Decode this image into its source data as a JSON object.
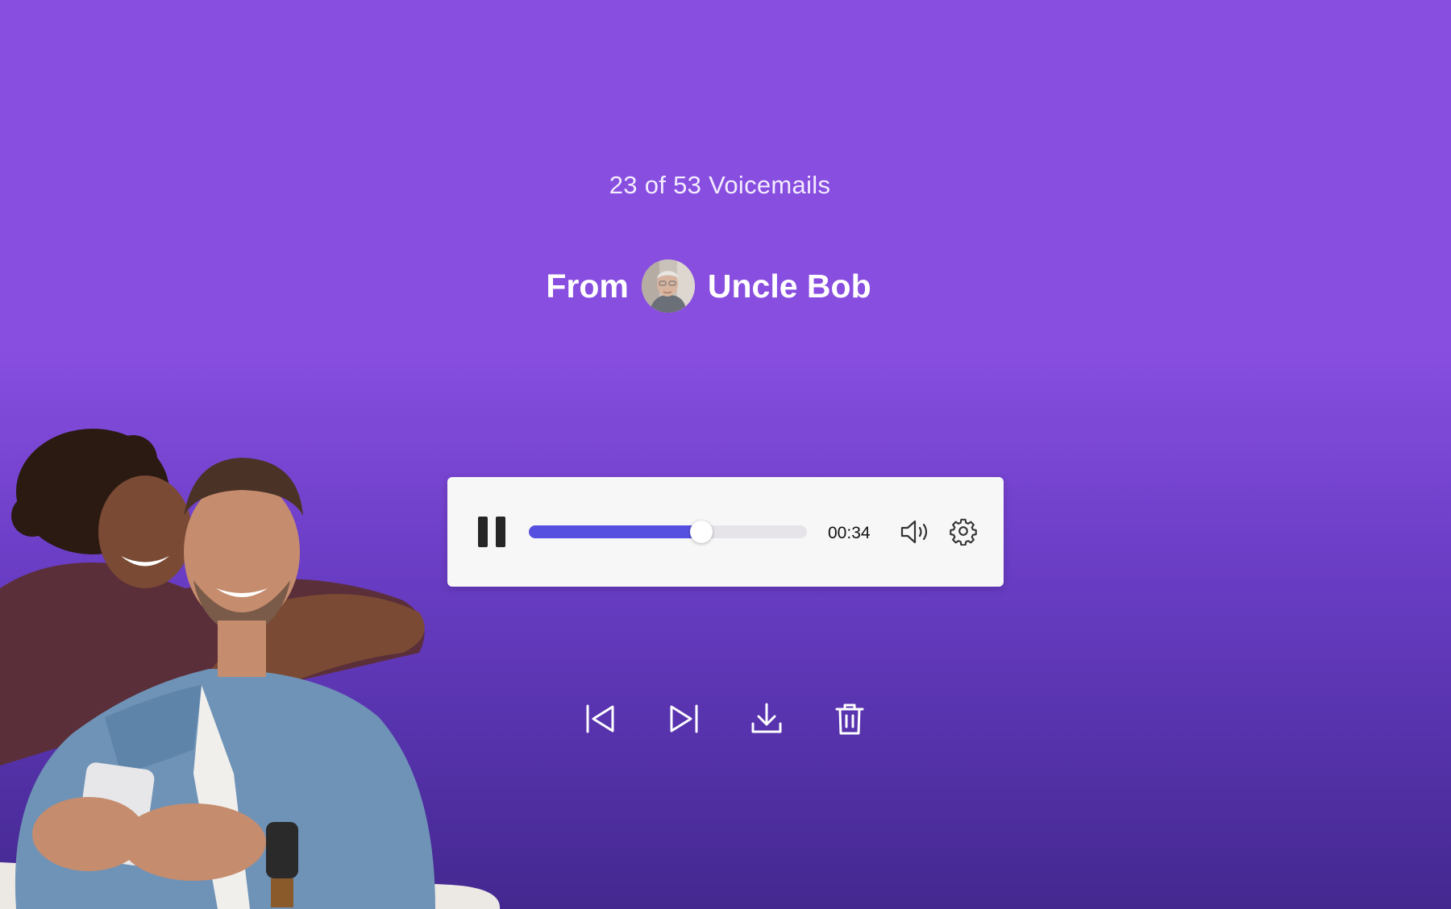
{
  "counter": {
    "current": 23,
    "total": 53,
    "text": "23 of 53 Voicemails"
  },
  "sender": {
    "prefix": "From",
    "name": "Uncle Bob",
    "avatar_icon": "avatar-photo"
  },
  "player": {
    "state": "playing",
    "play_pause_icon": "pause-icon",
    "progress_fraction": 0.62,
    "elapsed_time": "00:34",
    "volume_icon": "speaker-icon",
    "settings_icon": "gear-icon",
    "accent_color": "#5650e0"
  },
  "actions": [
    {
      "id": "previous",
      "icon": "skip-previous-icon"
    },
    {
      "id": "next",
      "icon": "skip-next-icon"
    },
    {
      "id": "download",
      "icon": "download-icon"
    },
    {
      "id": "delete",
      "icon": "trash-icon"
    }
  ],
  "theme": {
    "background_top": "#884ee0",
    "background_bottom": "#44288f",
    "card_background": "#f8f7f7"
  }
}
